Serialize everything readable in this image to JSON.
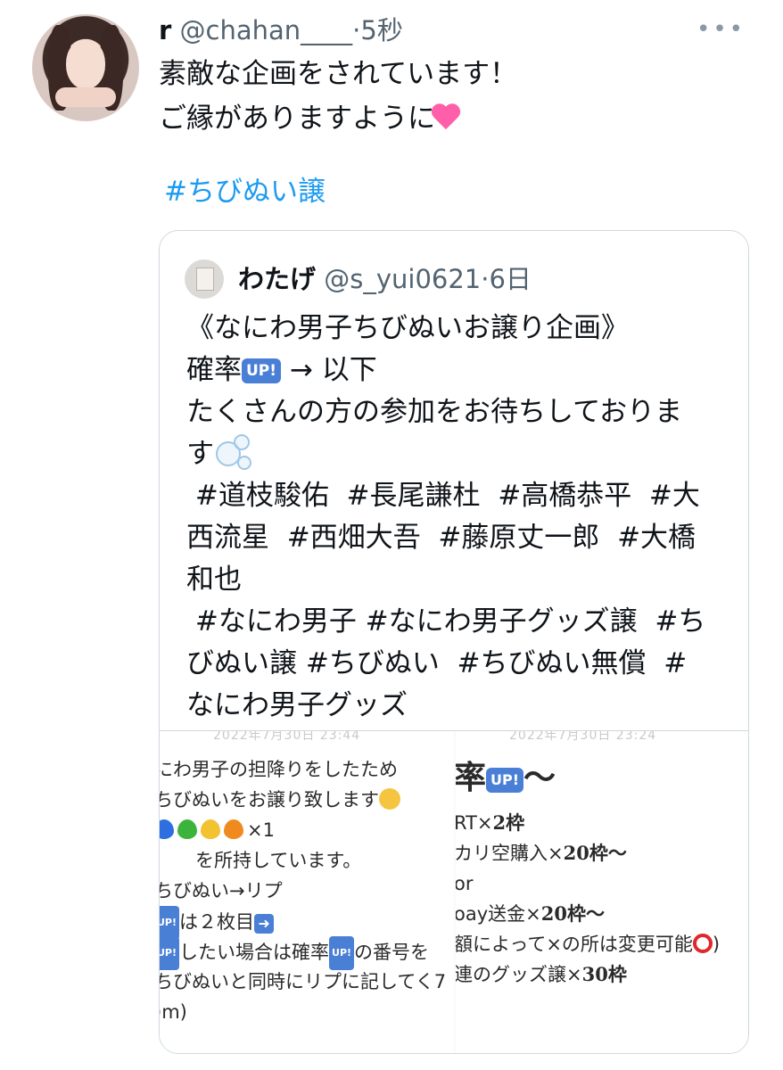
{
  "tweet": {
    "name": "r",
    "handle": "@chahan____",
    "separator": "·",
    "time": "5秒",
    "text_line1": "素敵な企画をされています！",
    "text_line2": "ご縁がありますように",
    "hashtag": "#ちびぬい譲",
    "more_icon": "more-dots-icon"
  },
  "quote": {
    "name": "わたげ",
    "handle": "@s_yui0621",
    "separator": "·",
    "time": "6日",
    "title": "《なにわ男子ちびぬいお譲り企画》",
    "prob_prefix": "確率",
    "up_label": "UP!",
    "prob_suffix": "→ 以下",
    "participate_line1": "たくさんの方の参加をお待ちしておりま",
    "participate_line2": "す",
    "tags_line1": " #道枝駿佑  #長尾謙杜  #高橋恭平  #大",
    "tags_line2": "西流星  #西畑大吾  #藤原丈一郎  #大橋",
    "tags_line3": "和也",
    "tags_line4": " #なにわ男子 #なにわ男子グッズ譲  #ち",
    "tags_line5": "びぬい譲 #ちびぬい  #ちびぬい無償  #",
    "tags_line6": "なにわ男子グッズ"
  },
  "media_left": {
    "faded_header": "2022年7月30日 23:44",
    "l1": "にわ男子の担降りをしたため",
    "l2": "ちびぬいをお譲り致します",
    "l3_suffix": "×1",
    "l4": "を所持しています。",
    "l5": "ちびぬい→リプ",
    "l6": "は２枚目",
    "l7a": "したい場合は確率",
    "l7b": "の番号を",
    "l8": "ちびぬいと同時にリプに記してく7",
    "l9": ")m)"
  },
  "media_right": {
    "faded_header": "2022年7月30日 23:24",
    "title": "率",
    "title_suffix": "〜",
    "r1a": "RT×",
    "r1b": "2枠",
    "r2a": "カリ空購入×",
    "r2b": "20枠〜",
    "r3": "or",
    "r4a": "oay送金×",
    "r4b": "20枠〜",
    "r5": "額によって×の所は変更可能",
    "r5_tail": ")",
    "r6a": "連のグッズ譲×",
    "r6b": "30枠"
  },
  "colors": {
    "link": "#1d9bf0",
    "secondary": "#536471",
    "up_badge": "#4a7fd6",
    "border": "#cfd9de"
  }
}
